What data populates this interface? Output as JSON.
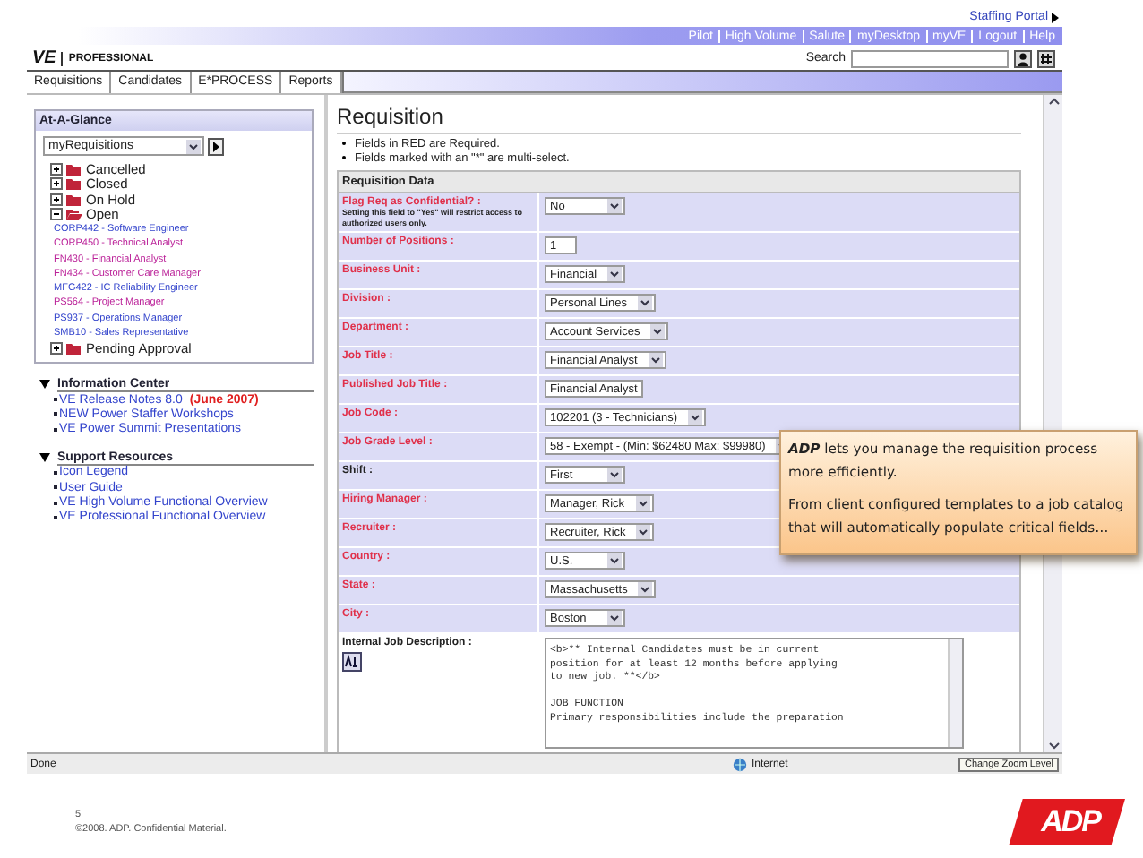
{
  "portal_link": "Staffing Portal",
  "top_links": [
    "Pilot",
    "High Volume",
    "Salute",
    "myDesktop",
    "myVE",
    "Logout",
    "Help"
  ],
  "logo": {
    "mark": "VE",
    "product": "PROFESSIONAL"
  },
  "search": {
    "label": "Search"
  },
  "tabs": [
    "Requisitions",
    "Candidates",
    "E*PROCESS",
    "Reports"
  ],
  "at_a_glance": {
    "title": "At-A-Glance",
    "view": "myRequisitions",
    "folders": [
      {
        "label": "Cancelled",
        "expanded": false
      },
      {
        "label": "Closed",
        "expanded": false
      },
      {
        "label": "On Hold",
        "expanded": false
      },
      {
        "label": "Open",
        "expanded": true,
        "children": [
          {
            "label": "CORP442 - Software Engineer",
            "color": "#3344cc"
          },
          {
            "label": "CORP450 - Technical Analyst",
            "color": "#bb2299"
          },
          {
            "label": "FN430 - Financial Analyst",
            "color": "#bb2299"
          },
          {
            "label": "FN434 - Customer Care Manager",
            "color": "#bb2299"
          },
          {
            "label": "MFG422 - IC Reliability Engineer",
            "color": "#3344cc"
          },
          {
            "label": "PS564 - Project Manager",
            "color": "#bb2299"
          },
          {
            "label": "PS937 - Operations Manager",
            "color": "#3344cc"
          },
          {
            "label": "SMB10 - Sales Representative",
            "color": "#3344cc"
          }
        ]
      },
      {
        "label": "Pending Approval",
        "expanded": false
      }
    ]
  },
  "information_center": {
    "title": "Information Center",
    "links": [
      {
        "label": "VE Release Notes 8.0",
        "note": "(June 2007)"
      },
      {
        "label": "NEW Power Staffer Workshops"
      },
      {
        "label": "VE Power Summit Presentations"
      }
    ]
  },
  "support_resources": {
    "title": "Support Resources",
    "links": [
      {
        "label": "Icon Legend"
      },
      {
        "label": "User Guide"
      },
      {
        "label": "VE High Volume Functional Overview"
      },
      {
        "label": "VE Professional Functional Overview"
      }
    ]
  },
  "requisition": {
    "title": "Requisition",
    "notes": [
      "Fields in RED are Required.",
      "Fields marked with an \"*\" are multi-select."
    ],
    "section": "Requisition Data",
    "fields": [
      {
        "label": "Flag Req as Confidential? :",
        "hint": "Setting this field to \"Yes\" will restrict access to authorized users only.",
        "required": true,
        "kind": "select",
        "value": "No"
      },
      {
        "label": "Number of Positions :",
        "required": true,
        "kind": "text",
        "value": "1"
      },
      {
        "label": "Business Unit :",
        "required": true,
        "kind": "select",
        "value": "Financial"
      },
      {
        "label": "Division :",
        "required": true,
        "kind": "select",
        "value": "Personal Lines"
      },
      {
        "label": "Department :",
        "required": true,
        "kind": "select",
        "value": "Account Services"
      },
      {
        "label": "Job Title :",
        "required": true,
        "kind": "select",
        "value": "Financial Analyst"
      },
      {
        "label": "Published Job Title :",
        "required": true,
        "kind": "text",
        "value": "Financial Analyst"
      },
      {
        "label": "Job Code :",
        "required": true,
        "kind": "select",
        "value": "102201 (3 - Technicians)"
      },
      {
        "label": "Job Grade Level :",
        "required": true,
        "kind": "select",
        "value": "58 - Exempt - (Min: $62480 Max: $99980)"
      },
      {
        "label": "Shift :",
        "required": false,
        "kind": "select",
        "value": "First"
      },
      {
        "label": "Hiring Manager :",
        "required": true,
        "kind": "select",
        "value": "Manager, Rick"
      },
      {
        "label": "Recruiter :",
        "required": true,
        "kind": "select",
        "value": "Recruiter, Rick"
      },
      {
        "label": "Country :",
        "required": true,
        "kind": "select",
        "value": "U.S."
      },
      {
        "label": "State :",
        "required": true,
        "kind": "select",
        "value": "Massachusetts"
      },
      {
        "label": "City :",
        "required": true,
        "kind": "select",
        "value": "Boston"
      },
      {
        "label": "Internal Job Description :",
        "required": false,
        "kind": "textarea",
        "value": "<b>** Internal Candidates must be in current\nposition for at least 12 months before applying\nto new job. **</b>\n\nJOB FUNCTION\nPrimary responsibilities include the preparation"
      }
    ]
  },
  "status_bar": {
    "status": "Done",
    "zone": "Internet",
    "zoom": "Change Zoom Level"
  },
  "callout": {
    "paragraphs": [
      "**ADP** lets you manage the requisition process more efficiently.",
      "From client configured templates to a job catalog that will automatically populate critical fields…"
    ]
  },
  "footer": {
    "page": "5",
    "copyright": "©2008. ADP. Confidential Material.",
    "logo": "ADP"
  }
}
